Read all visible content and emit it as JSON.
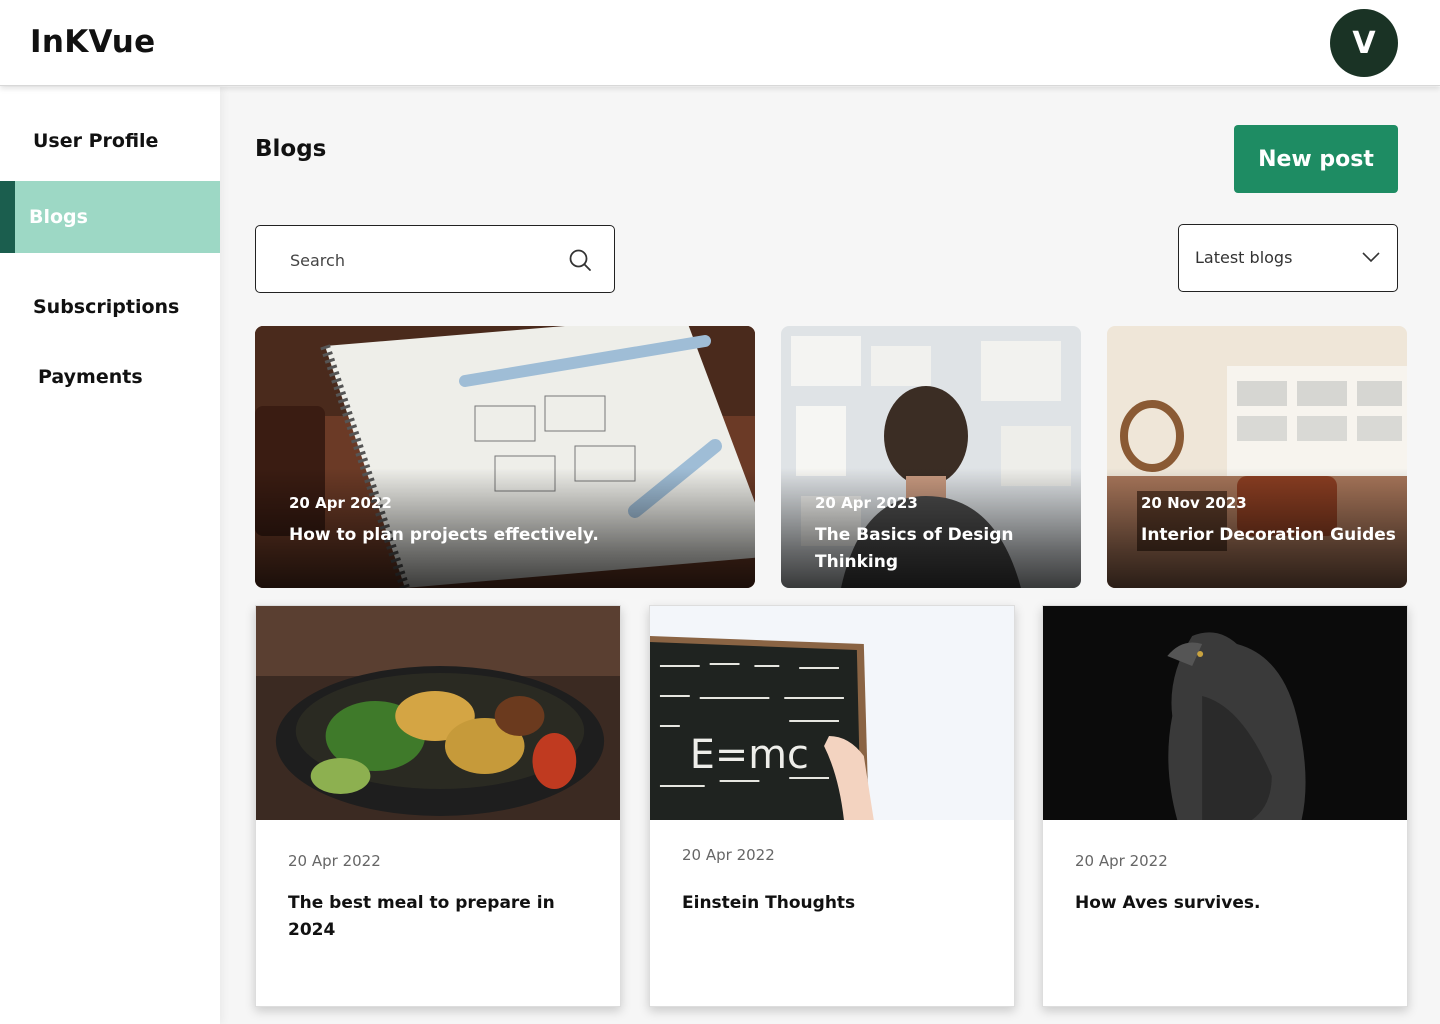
{
  "app": {
    "logo": "InKVue",
    "avatar_initial": "V"
  },
  "sidebar": {
    "items": [
      {
        "label": "User Profile",
        "active": false
      },
      {
        "label": "Blogs",
        "active": true
      },
      {
        "label": "Subscriptions",
        "active": false
      },
      {
        "label": "Payments",
        "active": false
      }
    ]
  },
  "main": {
    "title": "Blogs",
    "new_post_label": "New post",
    "search": {
      "placeholder": "Search",
      "value": ""
    },
    "sort": {
      "selected": "Latest blogs"
    }
  },
  "posts": [
    {
      "date": "20 Apr 2022",
      "title": "How to plan projects effectively."
    },
    {
      "date": "20 Apr 2023",
      "title": "The Basics of Design Thinking"
    },
    {
      "date": "20 Nov 2023",
      "title": "Interior Decoration Guides"
    },
    {
      "date": "20 Apr 2022",
      "title": "The best meal to prepare in 2024"
    },
    {
      "date": "20 Apr 2022",
      "title": "Einstein Thoughts"
    },
    {
      "date": "20 Apr 2022",
      "title": "How Aves survives."
    }
  ],
  "colors": {
    "brand_green": "#1e8c63",
    "active_tab": "#9dd8c5",
    "active_marker": "#1b5e4e",
    "avatar_bg": "#1a3325"
  },
  "icons": {
    "search": "search-icon",
    "dropdown": "chevron-down-icon"
  }
}
